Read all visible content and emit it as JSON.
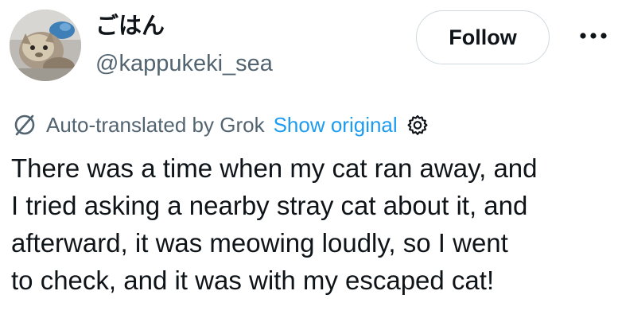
{
  "author": {
    "display_name": "ごはん",
    "handle": "@kappukeki_sea",
    "avatar_icon": "cat-figurine-avatar"
  },
  "actions": {
    "follow_label": "Follow",
    "more_icon": "more-dots-icon"
  },
  "translation": {
    "icon": "translate-slash-icon",
    "label": "Auto-translated by Grok",
    "show_original_label": "Show original",
    "settings_icon": "gear-icon"
  },
  "tweet": {
    "lines": [
      "There was a time when my cat ran away, and",
      "I tried asking a nearby stray cat about it, and",
      "afterward, it was meowing loudly, so I went",
      "to check, and it was with my escaped cat!"
    ]
  },
  "colors": {
    "text_primary": "#0f1419",
    "text_secondary": "#536471",
    "link": "#1d9bf0",
    "border": "#cfd9de"
  }
}
